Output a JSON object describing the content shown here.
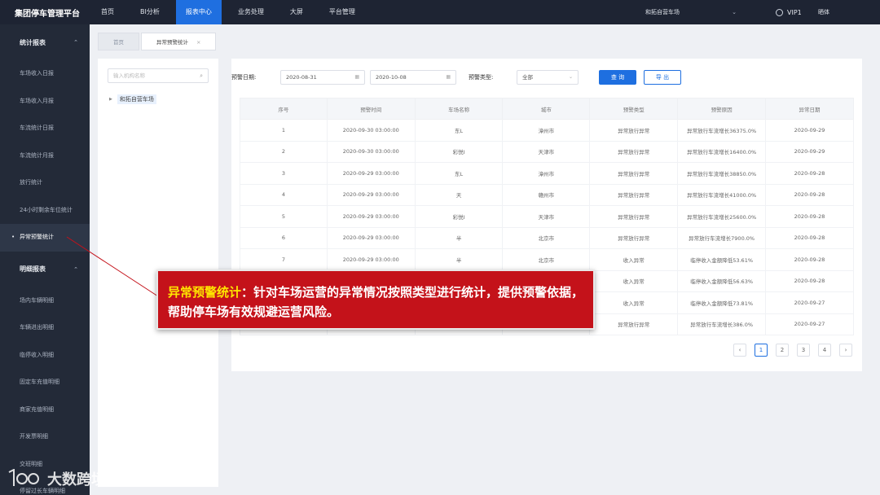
{
  "topbar": {
    "brand": "集团停车管理平台",
    "nav": [
      {
        "label": "首页",
        "active": false
      },
      {
        "label": "BI分析",
        "active": false
      },
      {
        "label": "报表中心",
        "active": true
      },
      {
        "label": "业务处理",
        "active": false
      },
      {
        "label": "大屏",
        "active": false
      },
      {
        "label": "平台管理",
        "active": false
      }
    ],
    "lot_select": "和拓自营车场",
    "user": "VIP1",
    "theme": "晒体"
  },
  "sidebar": {
    "group1": "统计报表",
    "group1_items": [
      "车场收入日报",
      "车场收入月报",
      "车流统计日报",
      "车流统计月报",
      "放行统计",
      "24小时剩余车位统计",
      "异常预警统计"
    ],
    "active_item": "异常预警统计",
    "group2": "明细报表",
    "group2_items": [
      "场内车辆明细",
      "车辆进出明细",
      "临停收入明细",
      "固定车充值明细",
      "商家充值明细",
      "开发票明细",
      "交班明细",
      "停留过长车辆明细"
    ]
  },
  "tabs": [
    {
      "label": "首页"
    },
    {
      "label": "异常预警统计",
      "close": "×"
    }
  ],
  "tree": {
    "search_placeholder": "输入机构名称",
    "search_icon": "search-icon",
    "node": "和拓自营车场"
  },
  "filter": {
    "date_label": "预警日期:",
    "start_date": "2020-08-31",
    "end_date": "2020-10-08",
    "type_label": "预警类型:",
    "type_value": "全部",
    "query_button": "查 询",
    "export_button": "导 出"
  },
  "table": {
    "headers": [
      "序号",
      "预警时间",
      "车场名称",
      "城市",
      "预警类型",
      "预警原因",
      "异常日期"
    ],
    "rows": [
      [
        "1",
        "2020-09-30 03:00:00",
        "东L",
        "漳州市",
        "异常放行异常",
        "异常放行车流增长36375.0%",
        "2020-09-29"
      ],
      [
        "2",
        "2020-09-30 03:00:00",
        "彩悦I",
        "天津市",
        "异常放行异常",
        "异常放行车流增长16400.0%",
        "2020-09-29"
      ],
      [
        "3",
        "2020-09-29 03:00:00",
        "东L",
        "漳州市",
        "异常放行异常",
        "异常放行车流增长38850.0%",
        "2020-09-28"
      ],
      [
        "4",
        "2020-09-29 03:00:00",
        "天",
        "赣州市",
        "异常放行异常",
        "异常放行车流增长41000.0%",
        "2020-09-28"
      ],
      [
        "5",
        "2020-09-29 03:00:00",
        "彩悦I",
        "天津市",
        "异常放行异常",
        "异常放行车流增长25600.0%",
        "2020-09-28"
      ],
      [
        "6",
        "2020-09-29 03:00:00",
        "半",
        "北京市",
        "异常放行异常",
        "异常放行车流增长7900.0%",
        "2020-09-28"
      ],
      [
        "7",
        "2020-09-29 03:00:00",
        "半",
        "北京市",
        "收入异常",
        "临停收入金额降低53.61%",
        "2020-09-28"
      ],
      [
        "",
        "",
        "",
        "",
        "收入异常",
        "临停收入金额降低56.63%",
        "2020-09-28"
      ],
      [
        "",
        "",
        "",
        "",
        "收入异常",
        "临停收入金额降低73.81%",
        "2020-09-27"
      ],
      [
        "",
        "",
        "",
        "",
        "异常放行异常",
        "异常放行车流增长386.0%",
        "2020-09-27"
      ]
    ]
  },
  "pager": {
    "prev": "‹",
    "pages": [
      "1",
      "2",
      "3",
      "4"
    ],
    "active": "1",
    "next": "›"
  },
  "callout": {
    "title": "异常预警统计",
    "body": "：针对车场运营的异常情况按照类型进行统计，提供预警依据，帮助停车场有效规避运营风险。",
    "bg_color": "#c4121a",
    "title_color": "#ffe600"
  },
  "watermark": "大数跨境"
}
